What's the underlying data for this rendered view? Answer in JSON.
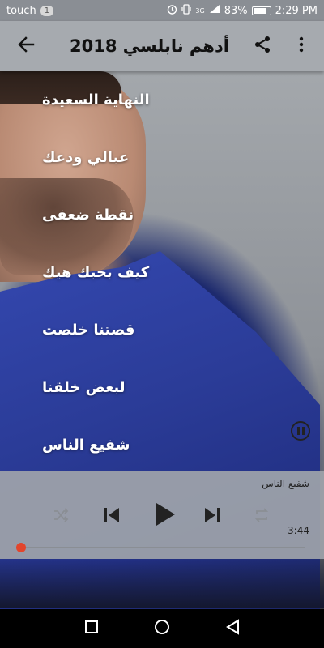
{
  "status_bar": {
    "carrier": "touch",
    "notification_count": "1",
    "signal_label": "3G",
    "battery_percent": "83%",
    "time": "2:29 PM"
  },
  "app_bar": {
    "title": "أدهم نابلسي 2018",
    "back_icon": "arrow-left-icon",
    "share_icon": "share-icon",
    "menu_icon": "more-vertical-icon"
  },
  "songs": [
    {
      "title": "النهاية السعيدة"
    },
    {
      "title": "عبالي ودعك"
    },
    {
      "title": "نقطة ضعفى"
    },
    {
      "title": "كيف بحبك هيك"
    },
    {
      "title": "قصتنا خلصت"
    },
    {
      "title": "لبعض خلقنا"
    },
    {
      "title": "شفيع الناس"
    }
  ],
  "player": {
    "now_playing": "شفيع الناس",
    "duration": "3:44",
    "progress": 0.0,
    "accent_color": "#e2452c"
  },
  "nav_bar": {
    "icons": [
      "square-recents-icon",
      "circle-home-icon",
      "triangle-back-icon"
    ]
  }
}
